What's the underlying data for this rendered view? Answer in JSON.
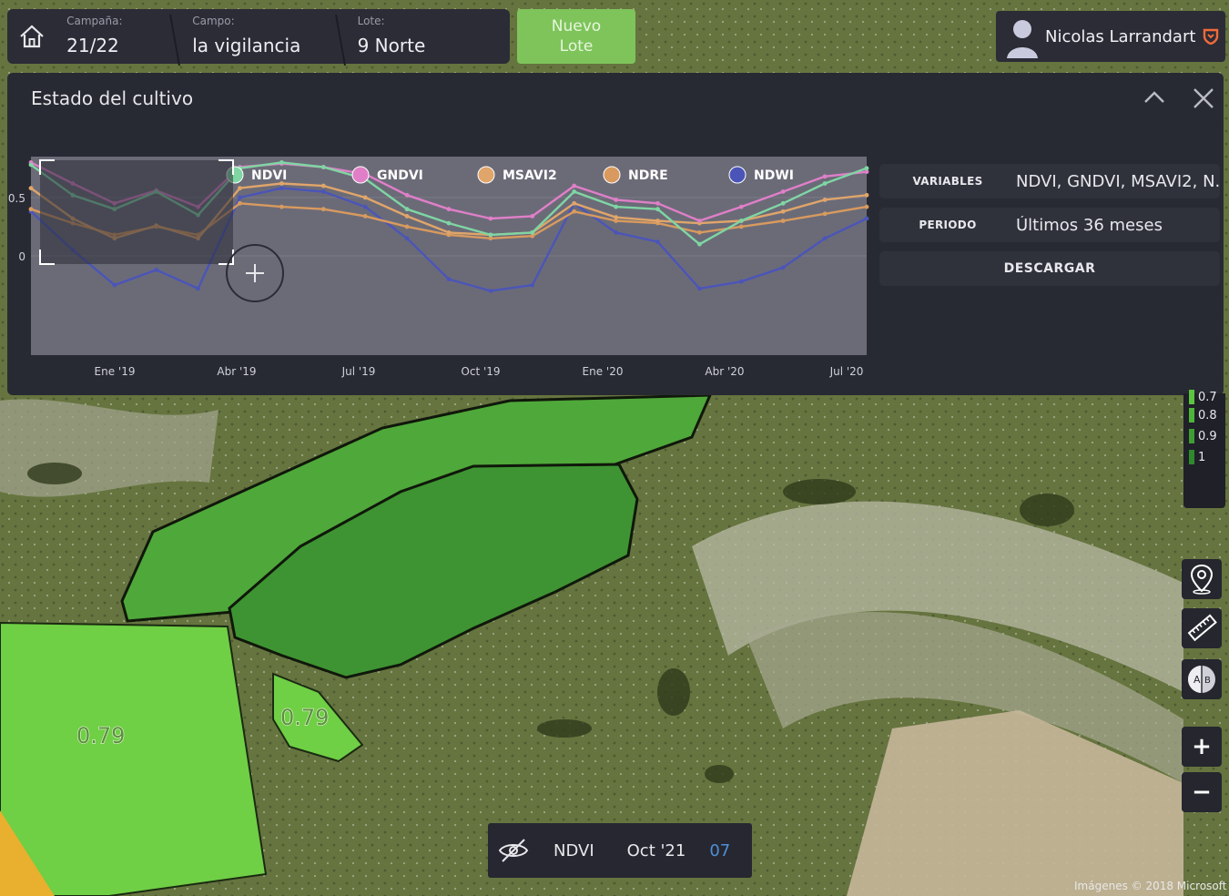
{
  "header": {
    "campana_caption": "Campaña:",
    "campana_value": "21/22",
    "campo_caption": "Campo:",
    "campo_value": "la vigilancia",
    "lote_caption": "Lote:",
    "lote_value": "9 Norte",
    "nuevo_lote_label": "Nuevo\nLote",
    "user_name": "Nicolas Larrandart"
  },
  "panel": {
    "title": "Estado del cultivo",
    "variables_label": "VARIABLES",
    "variables_value": "NDVI, GNDVI, MSAVI2, N...",
    "periodo_label": "PERIODO",
    "periodo_value": "Últimos 36 meses",
    "descargar_label": "DESCARGAR"
  },
  "chart_data": {
    "type": "line",
    "x_ticks": [
      "Ene '19",
      "Abr '19",
      "Jul '19",
      "Oct '19",
      "Ene '20",
      "Abr '20",
      "Jul '20"
    ],
    "y_ticks": [
      "0.5",
      "0"
    ],
    "ylim": [
      -0.85,
      0.85
    ],
    "x": [
      "Dic '18",
      "Ene '19",
      "Feb '19",
      "Mar '19",
      "Abr '19",
      "May '19",
      "Jun '19",
      "Jul '19",
      "Ago '19",
      "Sep '19",
      "Oct '19",
      "Nov '19",
      "Dic '19",
      "Ene '20",
      "Feb '20",
      "Mar '20",
      "Abr '20",
      "May '20",
      "Jun '20",
      "Jul '20",
      "Ago '20"
    ],
    "series": [
      {
        "name": "NDVI",
        "color": "#7fd6a3",
        "values": [
          0.78,
          0.52,
          0.4,
          0.55,
          0.35,
          0.75,
          0.8,
          0.76,
          0.66,
          0.4,
          0.28,
          0.18,
          0.2,
          0.55,
          0.42,
          0.4,
          0.1,
          0.3,
          0.45,
          0.62,
          0.75
        ]
      },
      {
        "name": "GNDVI",
        "color": "#e07fc8",
        "values": [
          0.8,
          0.62,
          0.45,
          0.56,
          0.42,
          0.76,
          0.79,
          0.76,
          0.7,
          0.52,
          0.4,
          0.32,
          0.34,
          0.6,
          0.48,
          0.45,
          0.3,
          0.42,
          0.55,
          0.68,
          0.72
        ]
      },
      {
        "name": "MSAVI2",
        "color": "#e0a56a",
        "values": [
          0.58,
          0.32,
          0.15,
          0.26,
          0.15,
          0.58,
          0.62,
          0.6,
          0.5,
          0.34,
          0.2,
          0.18,
          0.2,
          0.45,
          0.33,
          0.3,
          0.28,
          0.3,
          0.38,
          0.48,
          0.52
        ]
      },
      {
        "name": "NDRE",
        "color": "#d89a5e",
        "values": [
          0.4,
          0.28,
          0.18,
          0.25,
          0.18,
          0.45,
          0.42,
          0.4,
          0.34,
          0.25,
          0.18,
          0.15,
          0.17,
          0.38,
          0.3,
          0.28,
          0.2,
          0.25,
          0.3,
          0.36,
          0.42
        ]
      },
      {
        "name": "NDWI",
        "color": "#4b55b8",
        "values": [
          0.38,
          0.05,
          -0.25,
          -0.12,
          -0.28,
          0.5,
          0.58,
          0.55,
          0.42,
          0.15,
          -0.2,
          -0.3,
          -0.25,
          0.45,
          0.2,
          0.12,
          -0.28,
          -0.22,
          -0.1,
          0.15,
          0.32
        ]
      }
    ]
  },
  "legend": [
    {
      "label": "0.7",
      "color": "#5cc43e"
    },
    {
      "label": "0.8",
      "color": "#4db53a"
    },
    {
      "label": "0.9",
      "color": "#3e9e33"
    },
    {
      "label": "1",
      "color": "#2f8a2c"
    }
  ],
  "map": {
    "field_label_a": "0.79",
    "field_label_b": "0.79"
  },
  "bottom_bar": {
    "index": "NDVI",
    "date": "Oct '21",
    "day": "07"
  },
  "attribution": "Imágenes © 2018 Microsoft",
  "tools": [
    "location-pin-icon",
    "ruler-icon",
    "compare-ab-icon",
    "zoom-in-icon",
    "zoom-out-icon"
  ]
}
